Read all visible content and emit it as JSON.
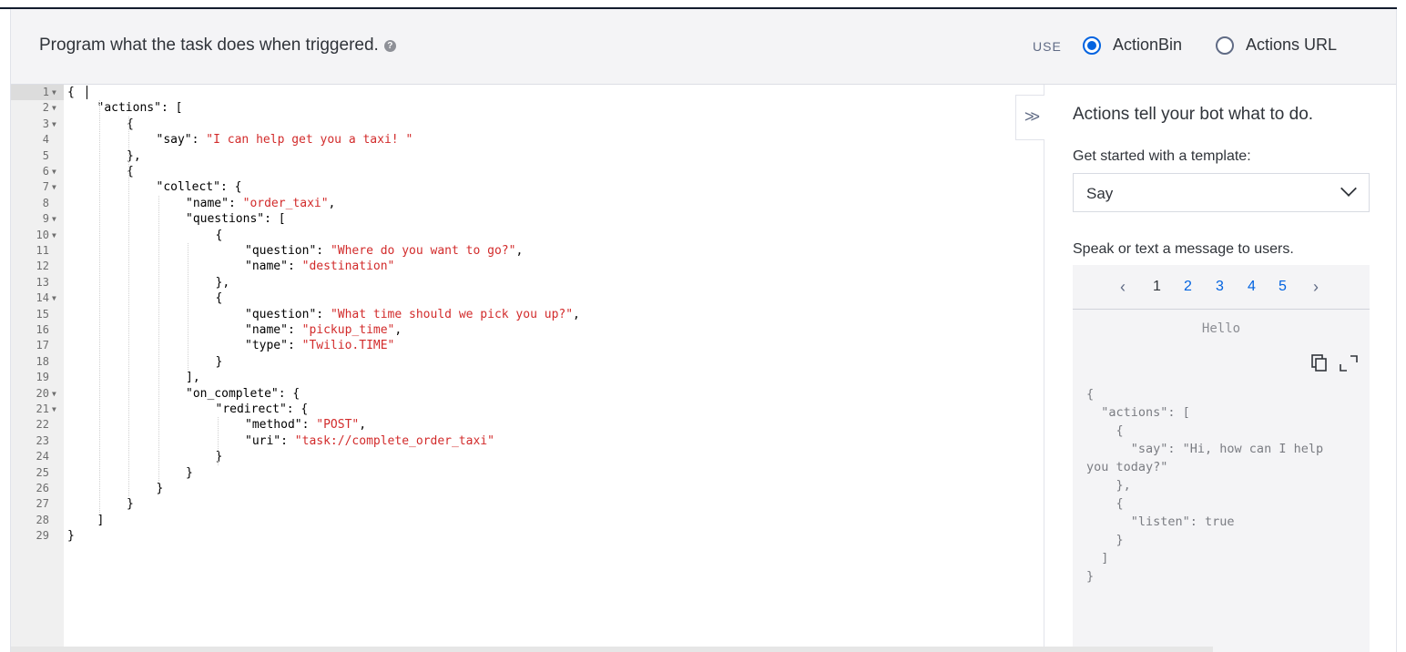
{
  "header": {
    "title": "Program what the task does when triggered.",
    "help_icon": "question-circle-icon",
    "use_label": "USE",
    "options": [
      {
        "label": "ActionBin",
        "checked": true
      },
      {
        "label": "Actions URL",
        "checked": false
      }
    ]
  },
  "editor": {
    "lines": [
      {
        "n": "1",
        "fold": true,
        "indent": 0,
        "parts": [
          [
            "p",
            "{"
          ]
        ]
      },
      {
        "n": "2",
        "fold": true,
        "indent": 1,
        "parts": [
          [
            "k",
            "\"actions\""
          ],
          [
            "p",
            ": ["
          ]
        ]
      },
      {
        "n": "3",
        "fold": true,
        "indent": 2,
        "parts": [
          [
            "p",
            "{"
          ]
        ]
      },
      {
        "n": "4",
        "fold": false,
        "indent": 3,
        "parts": [
          [
            "k",
            "\"say\""
          ],
          [
            "p",
            ": "
          ],
          [
            "s",
            "\"I can help get you a taxi! \""
          ]
        ]
      },
      {
        "n": "5",
        "fold": false,
        "indent": 2,
        "parts": [
          [
            "p",
            "},"
          ]
        ]
      },
      {
        "n": "6",
        "fold": true,
        "indent": 2,
        "parts": [
          [
            "p",
            "{"
          ]
        ]
      },
      {
        "n": "7",
        "fold": true,
        "indent": 3,
        "parts": [
          [
            "k",
            "\"collect\""
          ],
          [
            "p",
            ": {"
          ]
        ]
      },
      {
        "n": "8",
        "fold": false,
        "indent": 4,
        "parts": [
          [
            "k",
            "\"name\""
          ],
          [
            "p",
            ": "
          ],
          [
            "s",
            "\"order_taxi\""
          ],
          [
            "p",
            ","
          ]
        ]
      },
      {
        "n": "9",
        "fold": true,
        "indent": 4,
        "parts": [
          [
            "k",
            "\"questions\""
          ],
          [
            "p",
            ": ["
          ]
        ]
      },
      {
        "n": "10",
        "fold": true,
        "indent": 5,
        "parts": [
          [
            "p",
            "{"
          ]
        ]
      },
      {
        "n": "11",
        "fold": false,
        "indent": 6,
        "parts": [
          [
            "k",
            "\"question\""
          ],
          [
            "p",
            ": "
          ],
          [
            "s",
            "\"Where do you want to go?\""
          ],
          [
            "p",
            ","
          ]
        ]
      },
      {
        "n": "12",
        "fold": false,
        "indent": 6,
        "parts": [
          [
            "k",
            "\"name\""
          ],
          [
            "p",
            ": "
          ],
          [
            "s",
            "\"destination\""
          ]
        ]
      },
      {
        "n": "13",
        "fold": false,
        "indent": 5,
        "parts": [
          [
            "p",
            "},"
          ]
        ]
      },
      {
        "n": "14",
        "fold": true,
        "indent": 5,
        "parts": [
          [
            "p",
            "{"
          ]
        ]
      },
      {
        "n": "15",
        "fold": false,
        "indent": 6,
        "parts": [
          [
            "k",
            "\"question\""
          ],
          [
            "p",
            ": "
          ],
          [
            "s",
            "\"What time should we pick you up?\""
          ],
          [
            "p",
            ","
          ]
        ]
      },
      {
        "n": "16",
        "fold": false,
        "indent": 6,
        "parts": [
          [
            "k",
            "\"name\""
          ],
          [
            "p",
            ": "
          ],
          [
            "s",
            "\"pickup_time\""
          ],
          [
            "p",
            ","
          ]
        ]
      },
      {
        "n": "17",
        "fold": false,
        "indent": 6,
        "parts": [
          [
            "k",
            "\"type\""
          ],
          [
            "p",
            ": "
          ],
          [
            "s",
            "\"Twilio.TIME\""
          ]
        ]
      },
      {
        "n": "18",
        "fold": false,
        "indent": 5,
        "parts": [
          [
            "p",
            "}"
          ]
        ]
      },
      {
        "n": "19",
        "fold": false,
        "indent": 4,
        "parts": [
          [
            "p",
            "],"
          ]
        ]
      },
      {
        "n": "20",
        "fold": true,
        "indent": 4,
        "parts": [
          [
            "k",
            "\"on_complete\""
          ],
          [
            "p",
            ": {"
          ]
        ]
      },
      {
        "n": "21",
        "fold": true,
        "indent": 5,
        "parts": [
          [
            "k",
            "\"redirect\""
          ],
          [
            "p",
            ": {"
          ]
        ]
      },
      {
        "n": "22",
        "fold": false,
        "indent": 6,
        "parts": [
          [
            "k",
            "\"method\""
          ],
          [
            "p",
            ": "
          ],
          [
            "s",
            "\"POST\""
          ],
          [
            "p",
            ","
          ]
        ]
      },
      {
        "n": "23",
        "fold": false,
        "indent": 6,
        "parts": [
          [
            "k",
            "\"uri\""
          ],
          [
            "p",
            ": "
          ],
          [
            "s",
            "\"task://complete_order_taxi\""
          ]
        ]
      },
      {
        "n": "24",
        "fold": false,
        "indent": 5,
        "parts": [
          [
            "p",
            "}"
          ]
        ]
      },
      {
        "n": "25",
        "fold": false,
        "indent": 4,
        "parts": [
          [
            "p",
            "}"
          ]
        ]
      },
      {
        "n": "26",
        "fold": false,
        "indent": 3,
        "parts": [
          [
            "p",
            "}"
          ]
        ]
      },
      {
        "n": "27",
        "fold": false,
        "indent": 2,
        "parts": [
          [
            "p",
            "}"
          ]
        ]
      },
      {
        "n": "28",
        "fold": false,
        "indent": 1,
        "parts": [
          [
            "p",
            "]"
          ]
        ]
      },
      {
        "n": "29",
        "fold": false,
        "indent": 0,
        "parts": [
          [
            "p",
            "}"
          ]
        ]
      }
    ]
  },
  "collapse_icon": "double-chevron-right-icon",
  "sidebar": {
    "title": "Actions tell your bot what to do.",
    "template_label": "Get started with a template:",
    "template_value": "Say",
    "speak_label": "Speak or text a message to users.",
    "pages": [
      "1",
      "2",
      "3",
      "4",
      "5"
    ],
    "current_page": "1",
    "prev_icon": "chevron-left-icon",
    "next_icon": "chevron-right-icon",
    "preview_title": "Hello",
    "preview_json": "{\n  \"actions\": [\n    {\n      \"say\": \"Hi, how can I help\nyou today?\"\n    },\n    {\n      \"listen\": true\n    }\n  ]\n}"
  },
  "colors": {
    "accent": "#0263e0",
    "string": "#d22b2b",
    "header_bg": "#f4f4f6"
  }
}
